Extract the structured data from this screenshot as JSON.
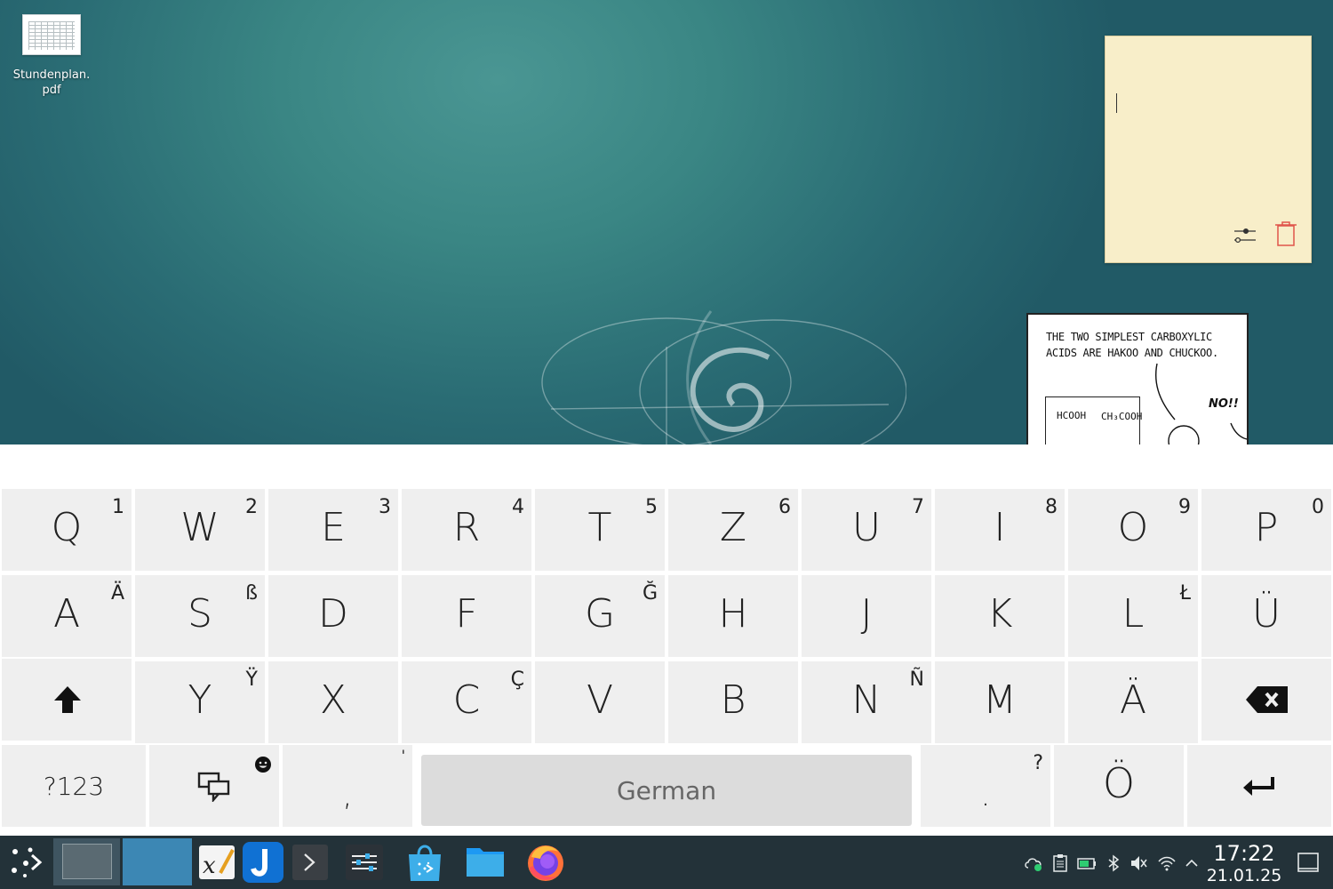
{
  "desktop": {
    "file_icon_name": "Stundenplan.\npdf",
    "file_name_line1": "Stundenplan.",
    "file_name_line2": "pdf",
    "note_settings_icon": "sliders-icon",
    "note_delete_icon": "trash-icon",
    "comic": {
      "caption_line1": "THE TWO SIMPLEST CARBOXYLIC",
      "caption_line2": "ACIDS ARE HAKOO AND CHUCKOO.",
      "exclaim": "NO!!",
      "formula1": "HCOOH",
      "formula2": "CH₃COOH"
    }
  },
  "keyboard": {
    "layout": "German",
    "row1": [
      {
        "key": "Q",
        "alt": "1"
      },
      {
        "key": "W",
        "alt": "2"
      },
      {
        "key": "E",
        "alt": "3"
      },
      {
        "key": "R",
        "alt": "4"
      },
      {
        "key": "T",
        "alt": "5"
      },
      {
        "key": "Z",
        "alt": "6"
      },
      {
        "key": "U",
        "alt": "7"
      },
      {
        "key": "I",
        "alt": "8"
      },
      {
        "key": "O",
        "alt": "9"
      },
      {
        "key": "P",
        "alt": "0"
      }
    ],
    "row2": [
      {
        "key": "A",
        "alt": "Ä"
      },
      {
        "key": "S",
        "alt": "ß"
      },
      {
        "key": "D",
        "alt": ""
      },
      {
        "key": "F",
        "alt": ""
      },
      {
        "key": "G",
        "alt": "Ğ"
      },
      {
        "key": "H",
        "alt": ""
      },
      {
        "key": "J",
        "alt": ""
      },
      {
        "key": "K",
        "alt": ""
      },
      {
        "key": "L",
        "alt": "Ł"
      },
      {
        "key": "Ü",
        "alt": ""
      }
    ],
    "row3": [
      {
        "key": "Y",
        "alt": "Ÿ"
      },
      {
        "key": "X",
        "alt": ""
      },
      {
        "key": "C",
        "alt": "Ç"
      },
      {
        "key": "V",
        "alt": ""
      },
      {
        "key": "B",
        "alt": ""
      },
      {
        "key": "N",
        "alt": "Ñ"
      },
      {
        "key": "M",
        "alt": ""
      },
      {
        "key": "Ä",
        "alt": ""
      }
    ],
    "shift_icon": "shift-arrow-icon",
    "backspace_icon": "backspace-icon",
    "symbols_label": "?123",
    "emoji_icon": "smiley-icon",
    "chat_icon": "chat-bubbles-icon",
    "comma_key": ",",
    "comma_alt": "'",
    "period_key": ".",
    "period_alt": "?",
    "o_umlaut_key": "Ö",
    "enter_icon": "enter-arrow-icon"
  },
  "taskbar": {
    "launcher_icon": "app-launcher-icon",
    "apps": [
      "xournal-icon",
      "joplin-icon",
      "terminal-icon",
      "system-settings-icon",
      "discover-store-icon",
      "file-manager-icon",
      "firefox-icon"
    ],
    "tray": [
      "cloud-sync-icon",
      "clipboard-icon",
      "battery-icon",
      "bluetooth-icon",
      "volume-muted-icon",
      "wifi-icon",
      "chevron-up-icon"
    ],
    "time": "17:22",
    "date": "21.01.25",
    "show_desktop_icon": "show-desktop-icon"
  }
}
